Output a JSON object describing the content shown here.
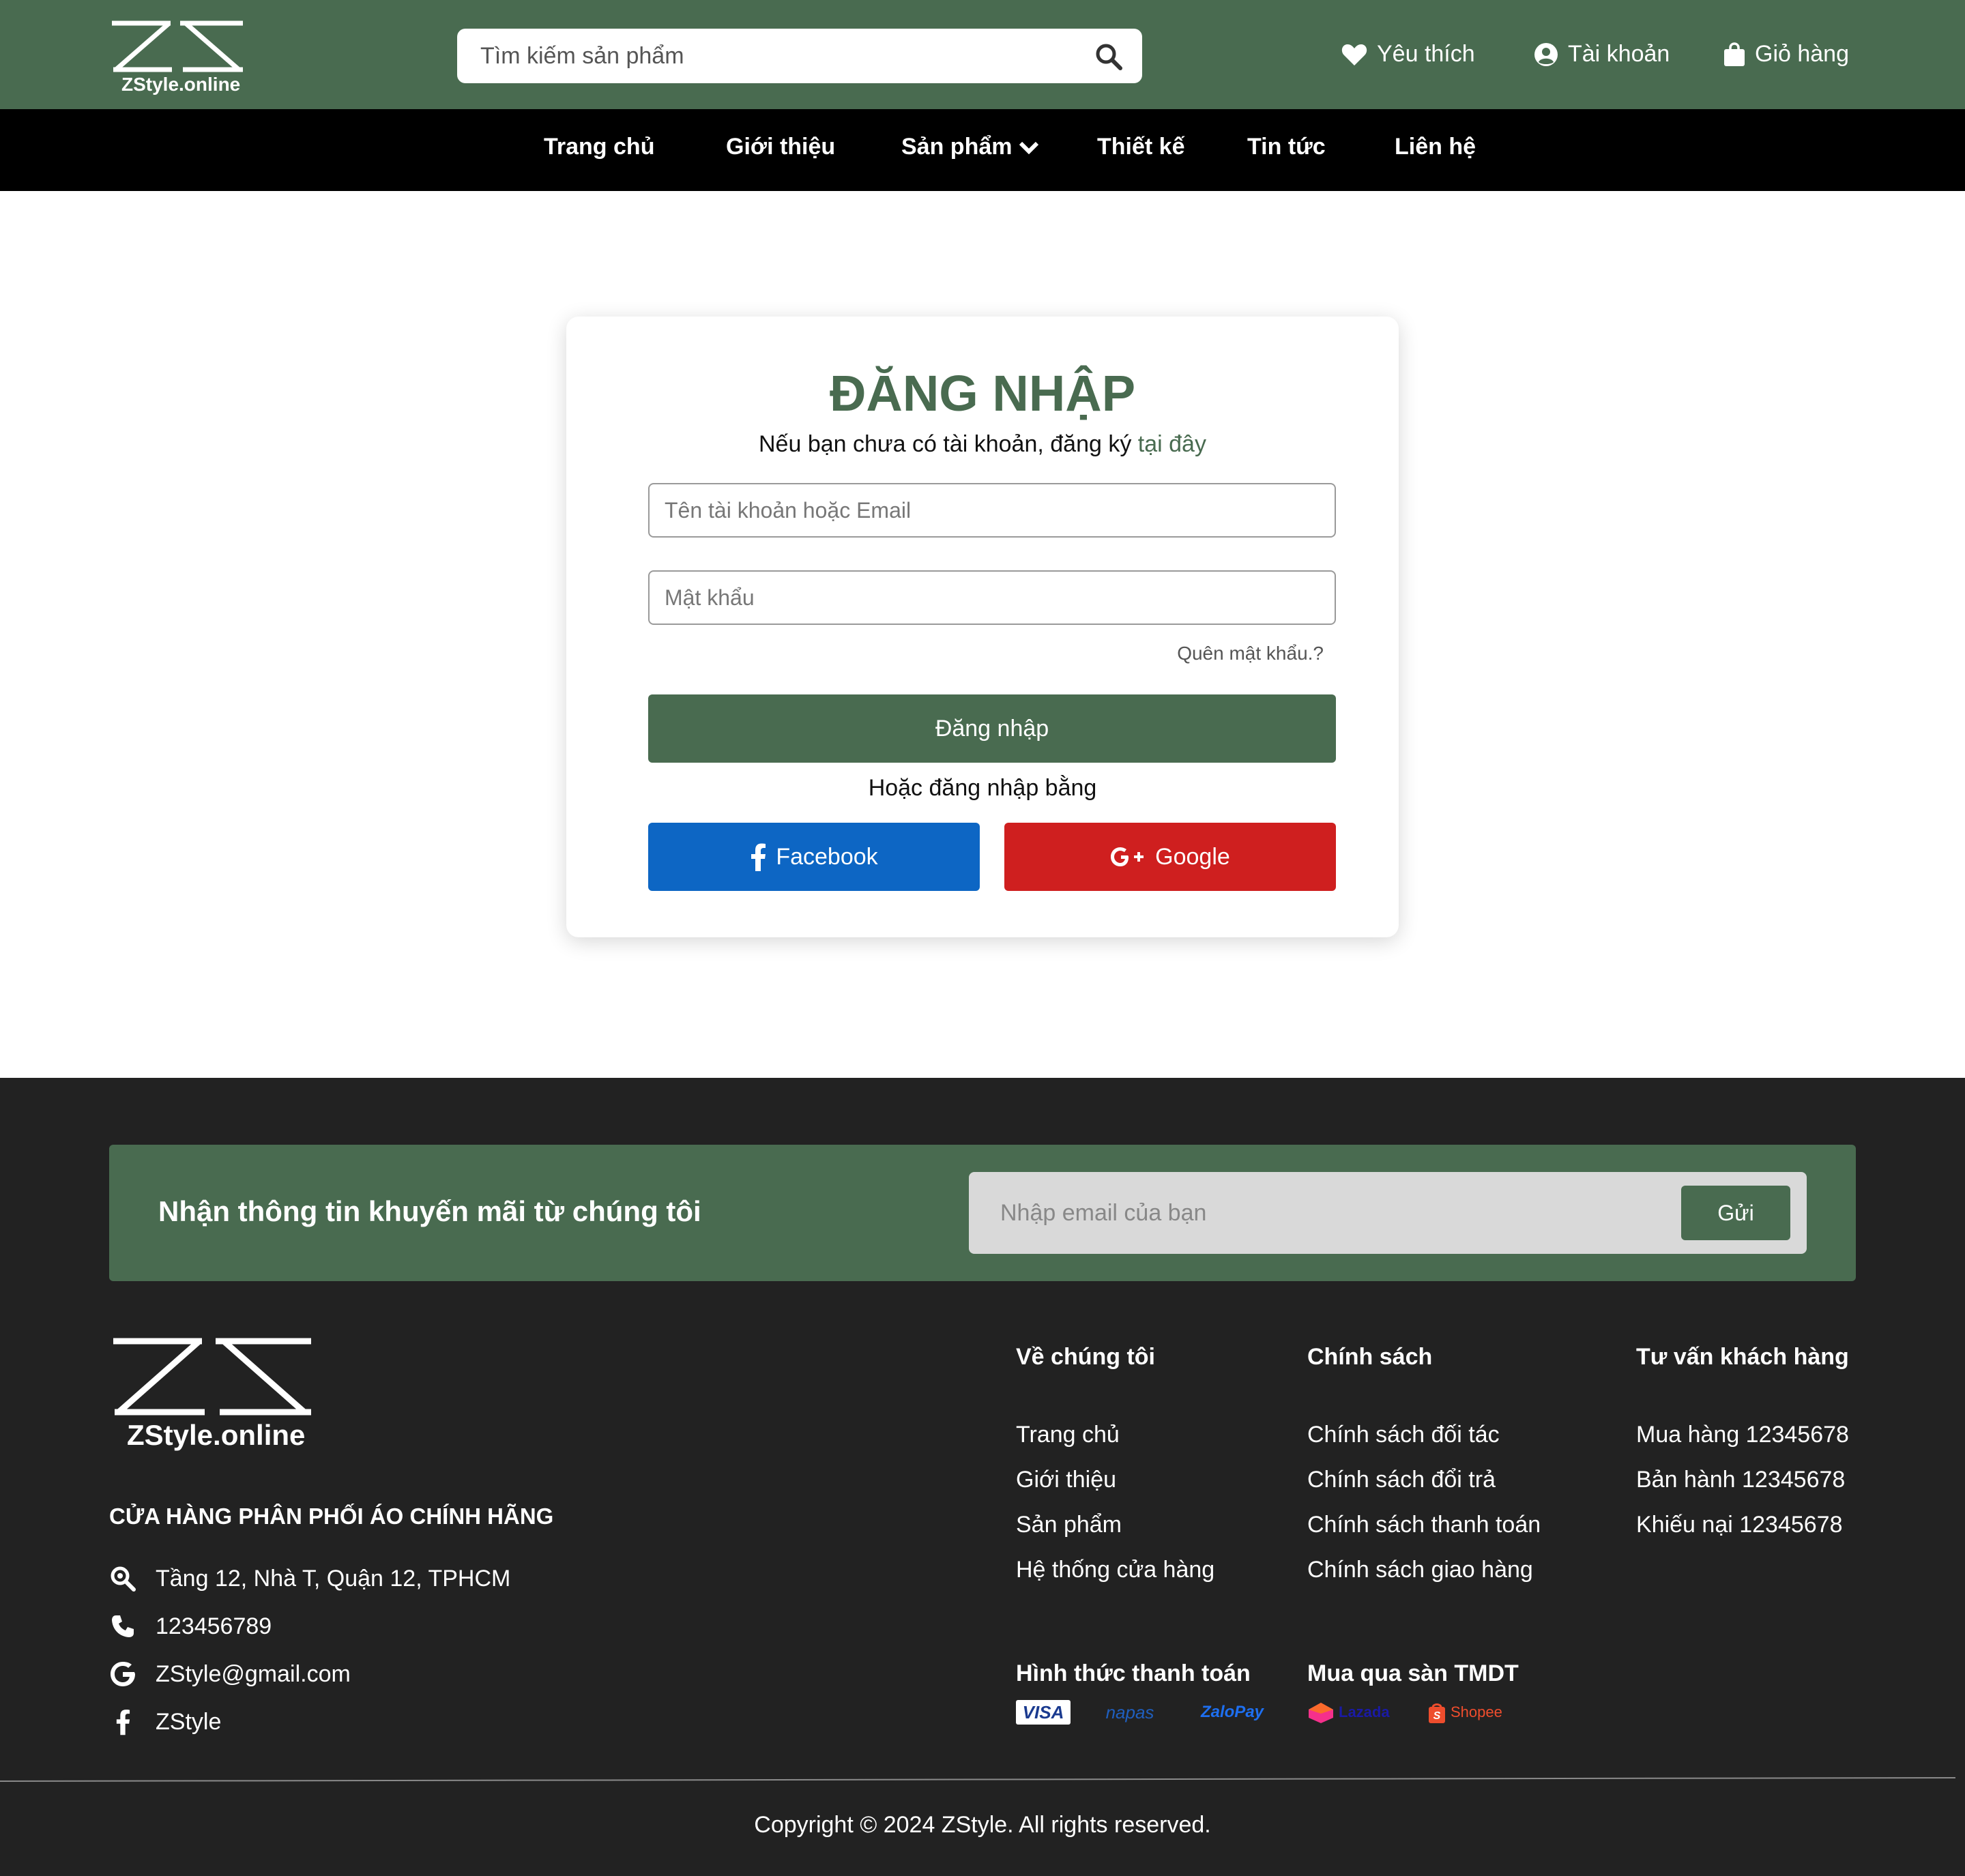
{
  "header": {
    "logo_text": "ZStyle.online",
    "search_placeholder": "Tìm kiếm sản phẩm",
    "wishlist_label": "Yêu thích",
    "account_label": "Tài khoản",
    "cart_label": "Giỏ hàng"
  },
  "nav": {
    "items": [
      "Trang chủ",
      "Giới thiệu",
      "Sản phẩm",
      "Thiết kế",
      "Tin tức",
      "Liên hệ"
    ]
  },
  "login": {
    "title": "ĐĂNG NHẬP",
    "subtitle": "Nếu bạn chưa có tài khoản, đăng ký ",
    "register_link": "tại đây",
    "username_placeholder": "Tên tài khoản hoặc Email",
    "password_placeholder": "Mật khẩu",
    "forgot_label": "Quên mật khẩu.?",
    "submit_label": "Đăng nhập",
    "or_text": "Hoặc đăng nhập bằng",
    "facebook_label": "Facebook",
    "google_label": "Google"
  },
  "footer": {
    "newsletter_title": "Nhận thông tin khuyến mãi từ chúng tôi",
    "newsletter_placeholder": "Nhập email của bạn",
    "newsletter_button": "Gửi",
    "logo_text": "ZStyle.online",
    "store_title": "CỬA HÀNG PHÂN PHỐI ÁO CHÍNH HÃNG",
    "contacts": {
      "address": "Tầng 12, Nhà T, Quận 12, TPHCM",
      "phone": "123456789",
      "email": "ZStyle@gmail.com",
      "facebook": "ZStyle"
    },
    "about": {
      "title": "Về chúng tôi",
      "links": [
        "Trang chủ",
        "Giới thiệu",
        "Sản phẩm",
        "Hệ thống cửa hàng"
      ]
    },
    "policy": {
      "title": "Chính sách",
      "links": [
        "Chính sách đối tác",
        "Chính sách đổi trả",
        "Chính sách thanh toán",
        "Chính sách giao hàng"
      ]
    },
    "support": {
      "title": "Tư vấn khách hàng",
      "links": [
        "Mua hàng 12345678",
        "Bản hành 12345678",
        "Khiếu nại 12345678"
      ]
    },
    "payment_title": "Hình thức thanh toán",
    "payment_logos": [
      "VISA",
      "napas",
      "ZaloPay"
    ],
    "marketplace_title": "Mua qua sàn TMDT",
    "marketplace_logos": [
      "Lazada",
      "Shopee"
    ],
    "copyright": "Copyright © 2024 ZStyle. All rights reserved."
  },
  "colors": {
    "brand_green": "#496b50",
    "nav_black": "#000000",
    "footer_dark": "#222222",
    "facebook_blue": "#0d66c4",
    "google_red": "#cf1f1f"
  },
  "icons": {
    "search": "search-icon",
    "heart": "heart-icon",
    "user": "user-circle-icon",
    "bag": "shopping-bag-icon",
    "chevron": "chevron-down-icon"
  }
}
